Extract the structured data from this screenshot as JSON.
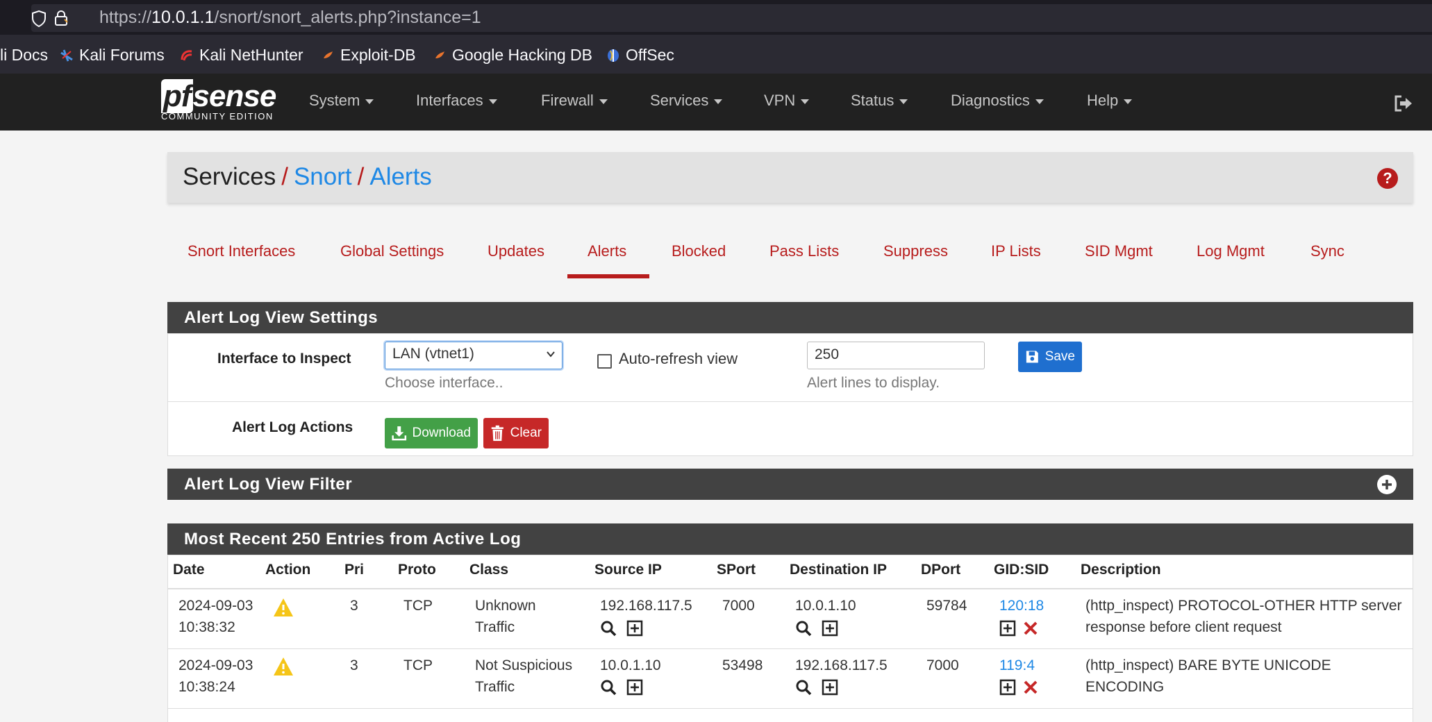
{
  "browser": {
    "url_prefix": "https://",
    "url_host": "10.0.1.1",
    "url_path": "/snort/snort_alerts.php?instance=1",
    "bookmarks": [
      {
        "label": "li Docs"
      },
      {
        "label": "Kali Forums"
      },
      {
        "label": "Kali NetHunter"
      },
      {
        "label": "Exploit-DB"
      },
      {
        "label": "Google Hacking DB"
      },
      {
        "label": "OffSec"
      }
    ]
  },
  "navbar": {
    "logo_text": "sense",
    "logo_pf": "pf",
    "logo_sub": "COMMUNITY EDITION",
    "items": [
      "System",
      "Interfaces",
      "Firewall",
      "Services",
      "VPN",
      "Status",
      "Diagnostics",
      "Help"
    ]
  },
  "breadcrumb": {
    "root": "Services",
    "sep": "/",
    "level1": "Snort",
    "level2": "Alerts"
  },
  "tabs": [
    "Snort Interfaces",
    "Global Settings",
    "Updates",
    "Alerts",
    "Blocked",
    "Pass Lists",
    "Suppress",
    "IP Lists",
    "SID Mgmt",
    "Log Mgmt",
    "Sync"
  ],
  "active_tab": "Alerts",
  "settings": {
    "title": "Alert Log View Settings",
    "interface_label": "Interface to Inspect",
    "interface_value": "LAN (vtnet1)",
    "interface_hint": "Choose interface..",
    "autorefresh_label": "Auto-refresh view",
    "autorefresh_checked": false,
    "lines_value": "250",
    "lines_hint": "Alert lines to display.",
    "save_label": "Save",
    "actions_label": "Alert Log Actions",
    "download_label": "Download",
    "clear_label": "Clear"
  },
  "filter": {
    "title": "Alert Log View Filter"
  },
  "entries": {
    "title": "Most Recent 250 Entries from Active Log",
    "columns": [
      "Date",
      "Action",
      "Pri",
      "Proto",
      "Class",
      "Source IP",
      "SPort",
      "Destination IP",
      "DPort",
      "GID:SID",
      "Description"
    ],
    "rows": [
      {
        "date1": "2024-09-03",
        "date2": "10:38:32",
        "pri": "3",
        "proto": "TCP",
        "class1": "Unknown",
        "class2": "Traffic",
        "src": "192.168.117.5",
        "sport": "7000",
        "dst": "10.0.1.10",
        "dport": "59784",
        "gidsid": "120:18",
        "desc1": "(http_inspect) PROTOCOL-OTHER HTTP server",
        "desc2": "response before client request"
      },
      {
        "date1": "2024-09-03",
        "date2": "10:38:24",
        "pri": "3",
        "proto": "TCP",
        "class1": "Not Suspicious",
        "class2": "Traffic",
        "src": "10.0.1.10",
        "sport": "53498",
        "dst": "192.168.117.5",
        "dport": "7000",
        "gidsid": "119:4",
        "desc1": "(http_inspect) BARE BYTE UNICODE",
        "desc2": "ENCODING"
      }
    ]
  },
  "colors": {
    "brand_red": "#b71c1c",
    "link_blue": "#1e88e5",
    "panel_dark": "#424242",
    "navbar": "#212121"
  }
}
